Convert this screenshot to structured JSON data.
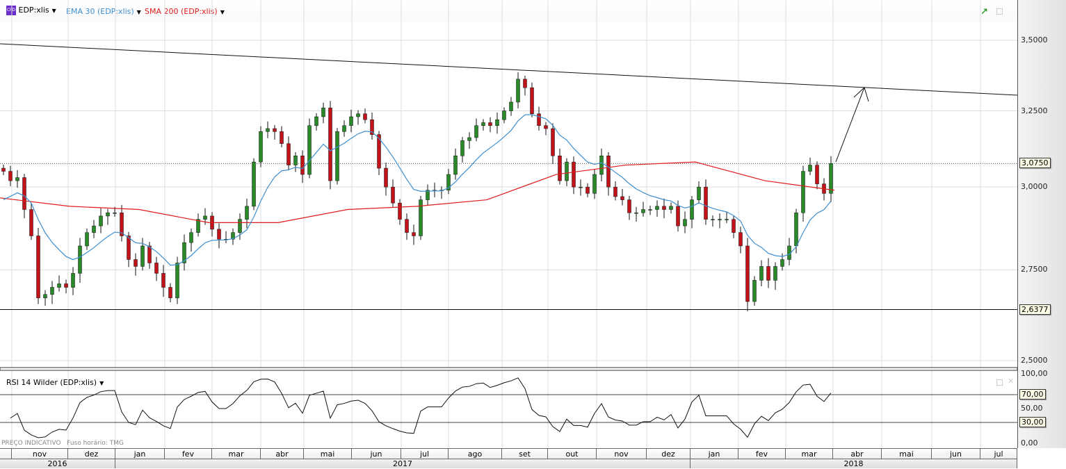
{
  "legend": {
    "symbol": "EDP:xlis",
    "badge": "CFD",
    "ema": "EMA 30 (EDP:xlis)",
    "sma": "SMA 200 (EDP:xlis)",
    "rsi": "RSI 14 Wilder (EDP:xlis)"
  },
  "footer": {
    "price_note": "PREÇO INDICATIVO",
    "timezone": "Fuso horário: TMG"
  },
  "colors": {
    "ema": "#3d8fd1",
    "sma": "#e01b1b",
    "up": "#2a8a2a",
    "down": "#c0141a"
  },
  "chart_data": {
    "type": "candlestick",
    "price_axis": {
      "ticks": [
        "3,5000",
        "3,2500",
        "3,0000",
        "2,7500",
        "2,5000"
      ],
      "tick_values": [
        3.5,
        3.25,
        3.0,
        2.75,
        2.5
      ],
      "scale": "log"
    },
    "last_price": {
      "value": 3.075,
      "label": "3,0750"
    },
    "support": {
      "value": 2.6377,
      "label": "2,6377"
    },
    "trendline": {
      "start": 3.48,
      "end": 3.3
    },
    "closes": [
      3.05,
      3.02,
      3.03,
      2.93,
      2.85,
      2.67,
      2.68,
      2.7,
      2.71,
      2.7,
      2.74,
      2.82,
      2.86,
      2.88,
      2.91,
      2.92,
      2.92,
      2.85,
      2.78,
      2.76,
      2.82,
      2.77,
      2.74,
      2.7,
      2.67,
      2.77,
      2.83,
      2.86,
      2.9,
      2.91,
      2.87,
      2.84,
      2.84,
      2.86,
      2.9,
      2.94,
      3.08,
      3.18,
      3.19,
      3.18,
      3.14,
      3.07,
      3.1,
      3.04,
      3.2,
      3.23,
      3.26,
      3.02,
      3.18,
      3.2,
      3.23,
      3.24,
      3.22,
      3.17,
      3.06,
      3.0,
      2.95,
      2.9,
      2.86,
      2.85,
      2.96,
      2.99,
      2.99,
      2.99,
      3.04,
      3.1,
      3.15,
      3.16,
      3.2,
      3.21,
      3.2,
      3.22,
      3.25,
      3.28,
      3.36,
      3.33,
      3.24,
      3.2,
      3.19,
      3.1,
      3.02,
      3.08,
      3.0,
      3.0,
      2.98,
      3.04,
      3.1,
      3.0,
      2.97,
      2.96,
      2.92,
      2.92,
      2.93,
      2.93,
      2.94,
      2.93,
      2.94,
      2.88,
      2.9,
      2.96,
      3.0,
      2.9,
      2.9,
      2.9,
      2.9,
      2.86,
      2.82,
      2.66,
      2.72,
      2.76,
      2.72,
      2.76,
      2.78,
      2.82,
      2.92,
      3.05,
      3.07,
      3.01,
      2.98,
      3.075
    ],
    "sma200": [
      2.966,
      2.94,
      2.93,
      2.89,
      2.89,
      2.93,
      2.94,
      2.96,
      3.04,
      3.07,
      3.08,
      3.02,
      2.99
    ],
    "rsi_axis": {
      "ticks": [
        "100,00",
        "50,00",
        "0,00"
      ],
      "levels": [
        70,
        30
      ],
      "level_labels": [
        "70,00",
        "30,00"
      ]
    },
    "months": [
      "nov",
      "dez",
      "jan",
      "fev",
      "mar",
      "abr",
      "mai",
      "jun",
      "jul",
      "ago",
      "set",
      "out",
      "nov",
      "dez",
      "jan",
      "fev",
      "mar",
      "abr",
      "mai",
      "jun",
      "jul"
    ],
    "years": [
      "2016",
      "2017",
      "2018"
    ]
  }
}
